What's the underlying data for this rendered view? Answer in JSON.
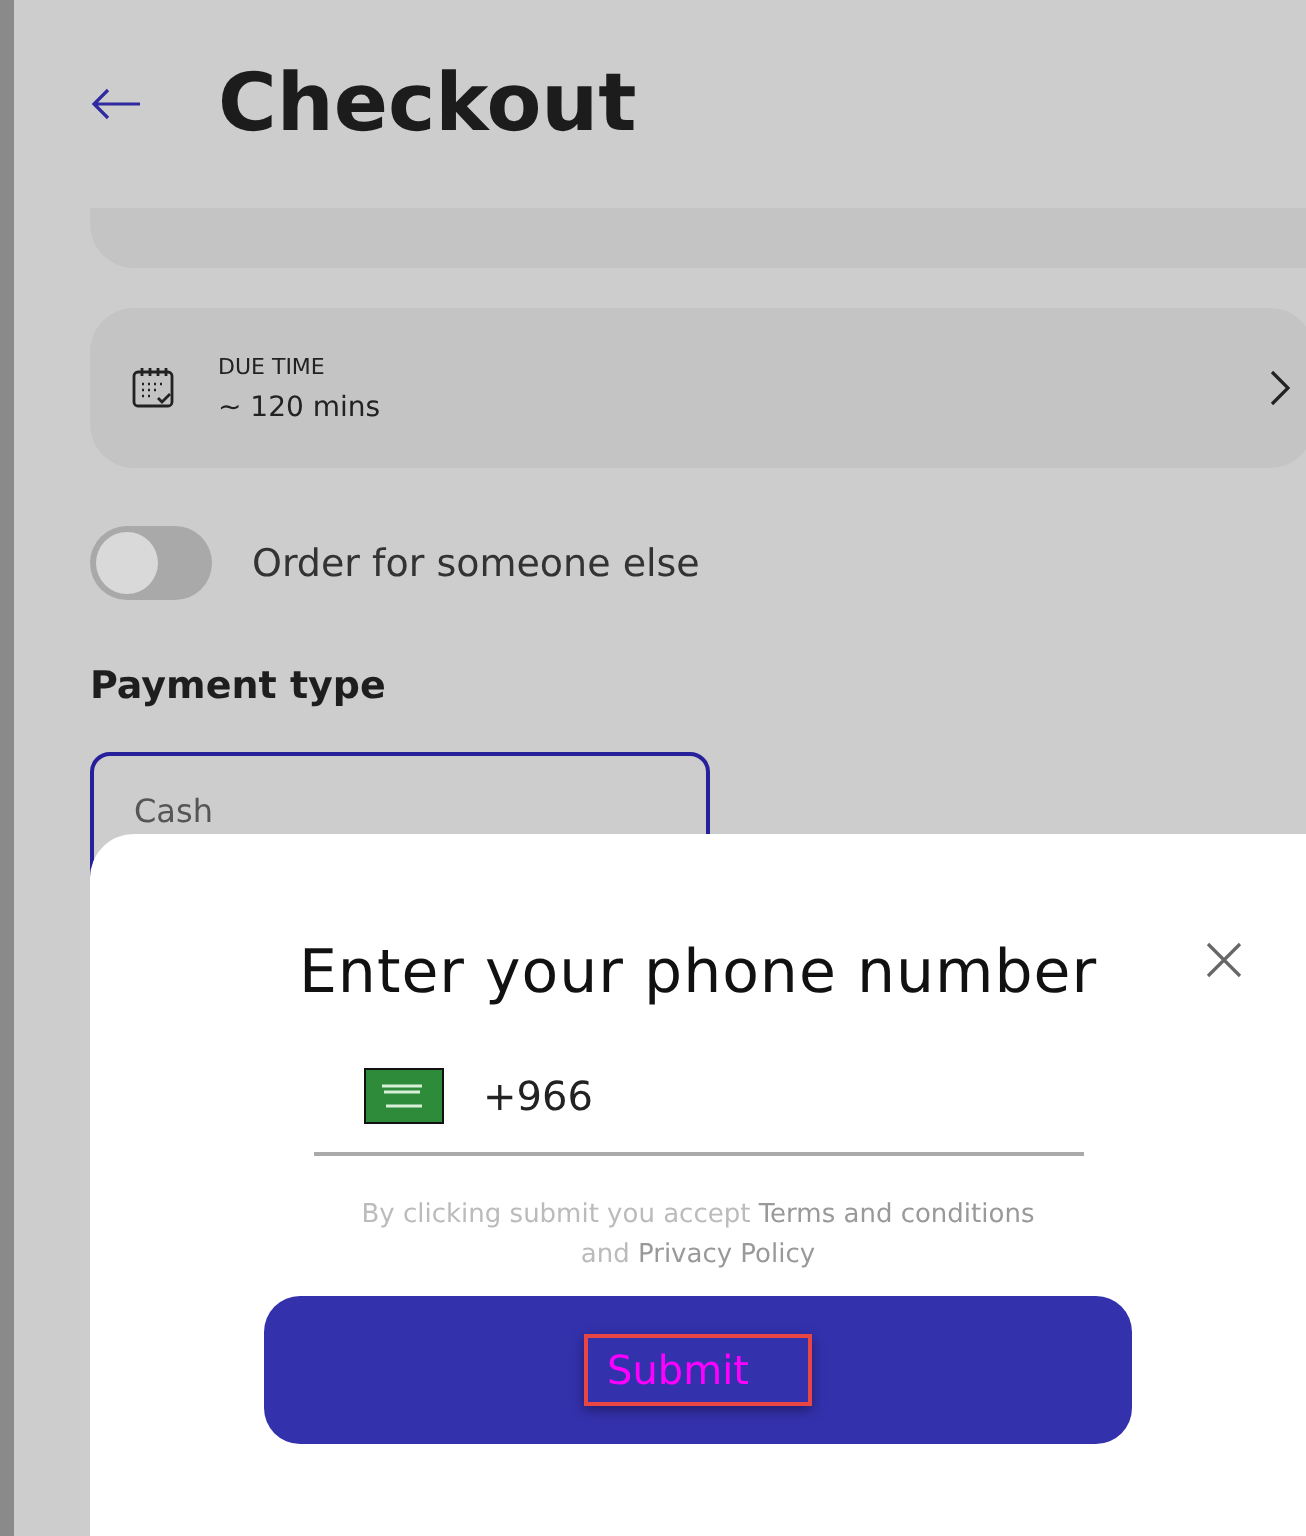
{
  "header": {
    "title": "Checkout"
  },
  "due_time": {
    "label": "DUE TIME",
    "value": "~ 120 mins"
  },
  "someone_else": {
    "label": "Order for someone else",
    "on": false
  },
  "payment": {
    "heading": "Payment type",
    "value": "Cash"
  },
  "modal": {
    "title": "Enter your phone number",
    "country_code": "+966",
    "terms": {
      "before": "By clicking submit you accept",
      "link1": "Terms and conditions",
      "middle": "and",
      "link2": "Privacy Policy"
    },
    "submit": "Submit"
  }
}
